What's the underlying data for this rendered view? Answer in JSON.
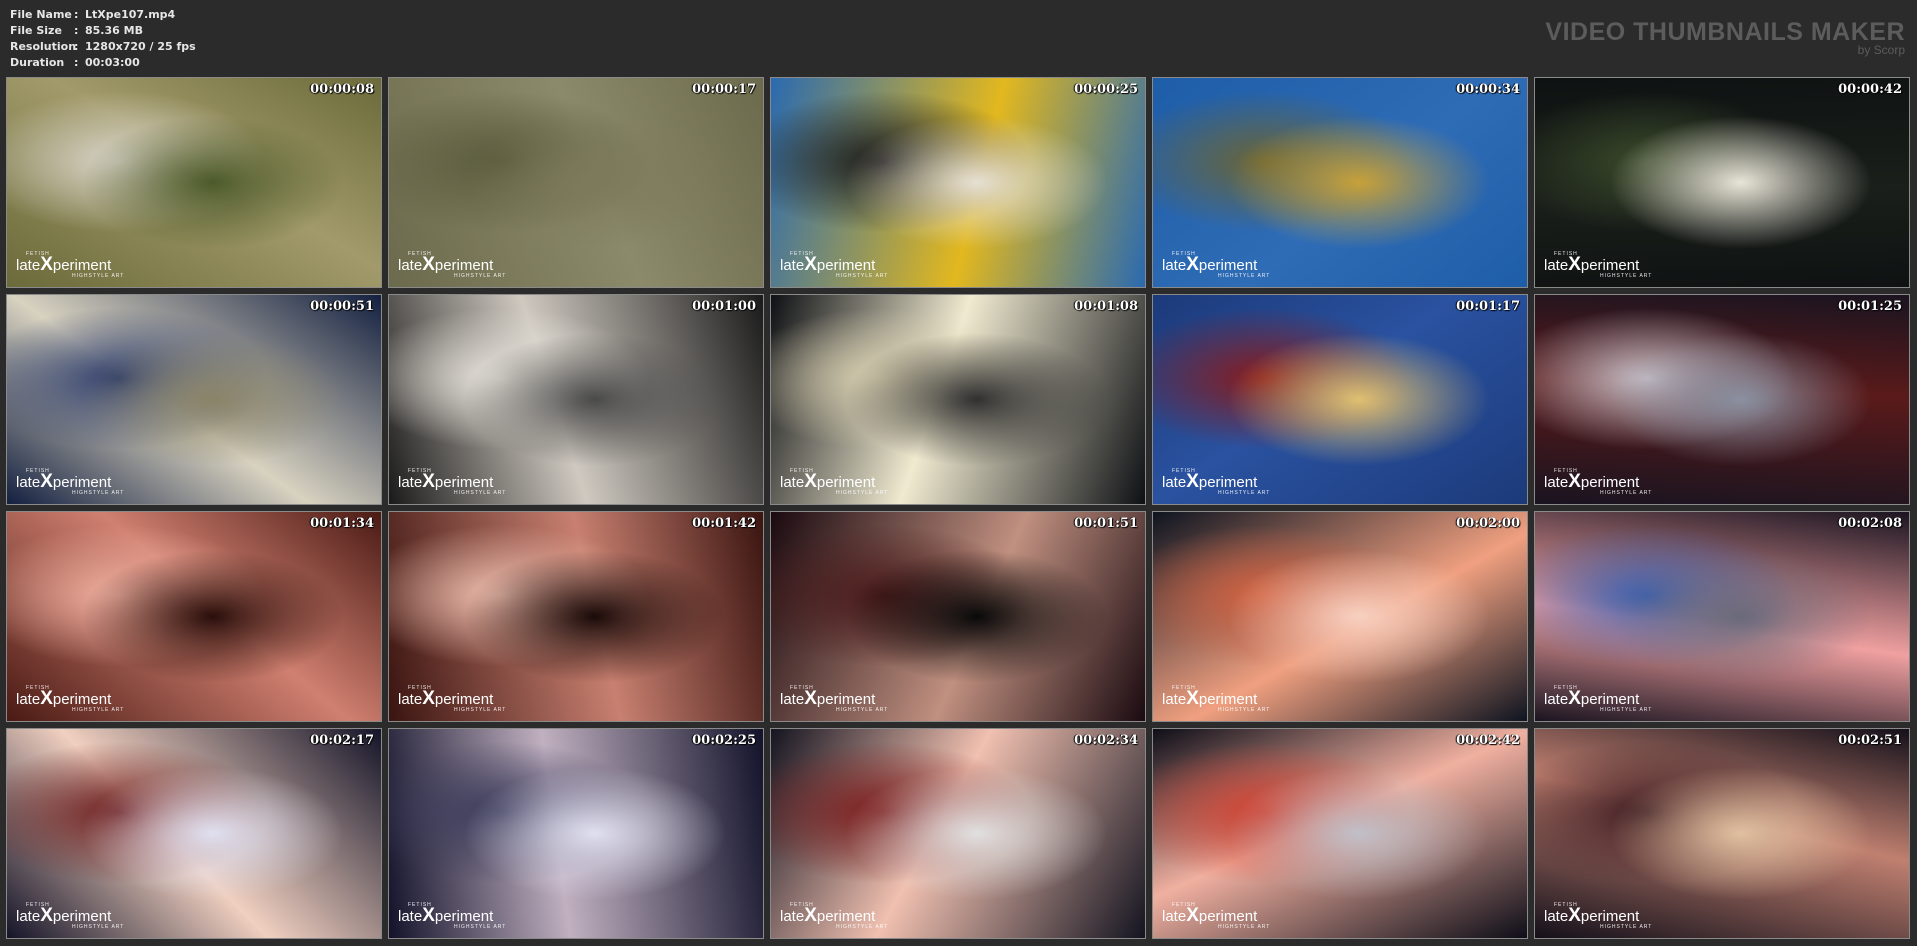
{
  "file_info": [
    {
      "label": "File Name",
      "value": "LtXpe107.mp4"
    },
    {
      "label": "File Size",
      "value": "85.36 MB"
    },
    {
      "label": "Resolution",
      "value": "1280x720 / 25 fps"
    },
    {
      "label": "Duration",
      "value": "00:03:00"
    }
  ],
  "separator": ":",
  "brand": {
    "title": "VIDEO THUMBNAILS MAKER",
    "subtitle": "by Scorp"
  },
  "watermark": {
    "top": "FETISH",
    "pre": "late",
    "x": "X",
    "post": "periment",
    "sub": "HIGHSTYLE ART"
  },
  "thumbnails": [
    {
      "timestamp": "00:00:08",
      "scene": "grass-boots",
      "colors": [
        "#6b6a3a",
        "#a29a6a",
        "#d8d4c8",
        "#4c5a2a"
      ]
    },
    {
      "timestamp": "00:00:17",
      "scene": "grass-pole",
      "colors": [
        "#6c6a4c",
        "#8b8a6a",
        "#5a5a3c",
        "#7c7a5a"
      ]
    },
    {
      "timestamp": "00:00:25",
      "scene": "tent-entrance",
      "colors": [
        "#2a6ab0",
        "#e2b81e",
        "#1a1a1a",
        "#e6e0d4"
      ]
    },
    {
      "timestamp": "00:00:34",
      "scene": "tent-canvas",
      "colors": [
        "#1e5da8",
        "#2f6cb6",
        "#6a6434",
        "#c7a13a"
      ]
    },
    {
      "timestamp": "00:00:42",
      "scene": "dark-interior",
      "colors": [
        "#0e1212",
        "#1a1f1a",
        "#3b4a2a",
        "#e8e4d8"
      ]
    },
    {
      "timestamp": "00:00:51",
      "scene": "suit-standing",
      "colors": [
        "#132040",
        "#d8d2c0",
        "#2a3a6a",
        "#8a8468"
      ]
    },
    {
      "timestamp": "00:01:00",
      "scene": "boot-steps",
      "colors": [
        "#1a1a1a",
        "#cfc9c0",
        "#e8e4dc",
        "#4a4a4a"
      ]
    },
    {
      "timestamp": "00:01:08",
      "scene": "suit-closeup",
      "colors": [
        "#0e1014",
        "#f0ead0",
        "#d8cfb0",
        "#303030"
      ]
    },
    {
      "timestamp": "00:01:17",
      "scene": "tent-curtain",
      "colors": [
        "#1c3a7a",
        "#2a52a0",
        "#8a1a1a",
        "#e0c070"
      ]
    },
    {
      "timestamp": "00:01:25",
      "scene": "stage-figure",
      "colors": [
        "#1a1420",
        "#5a1a1a",
        "#c8c0c8",
        "#8a90a0"
      ]
    },
    {
      "timestamp": "00:01:34",
      "scene": "red-closeup",
      "colors": [
        "#4a1a14",
        "#d08070",
        "#f0b0a0",
        "#2a0e0a"
      ]
    },
    {
      "timestamp": "00:01:42",
      "scene": "red-boot",
      "colors": [
        "#3a1410",
        "#c88070",
        "#f0c0b0",
        "#1a0a08"
      ]
    },
    {
      "timestamp": "00:01:51",
      "scene": "tent-top",
      "colors": [
        "#1a0a10",
        "#c09080",
        "#4a1a1a",
        "#0a0a0a"
      ]
    },
    {
      "timestamp": "00:02:00",
      "scene": "trapeze",
      "colors": [
        "#0e1420",
        "#f0a080",
        "#d06040",
        "#f8d0c0"
      ]
    },
    {
      "timestamp": "00:02:08",
      "scene": "heels-rail",
      "colors": [
        "#1a1420",
        "#f0a0a0",
        "#3a60b0",
        "#6a6a7a"
      ]
    },
    {
      "timestamp": "00:02:17",
      "scene": "pole-lights",
      "colors": [
        "#141428",
        "#f0d0c0",
        "#6a1a1a",
        "#e0e0f0"
      ]
    },
    {
      "timestamp": "00:02:25",
      "scene": "star-lights",
      "colors": [
        "#12122a",
        "#c0b0c0",
        "#3a3a5a",
        "#e0e0f0"
      ]
    },
    {
      "timestamp": "00:02:34",
      "scene": "pole-split",
      "colors": [
        "#141420",
        "#f0c0b0",
        "#7a1a1a",
        "#e0e0e0"
      ]
    },
    {
      "timestamp": "00:02:42",
      "scene": "pole-climb",
      "colors": [
        "#0e0e18",
        "#f0b0a0",
        "#d04030",
        "#c0c0c8"
      ]
    },
    {
      "timestamp": "00:02:51",
      "scene": "tent-ceiling",
      "colors": [
        "#14101a",
        "#c08070",
        "#3a1a20",
        "#e0c0a0"
      ]
    }
  ]
}
